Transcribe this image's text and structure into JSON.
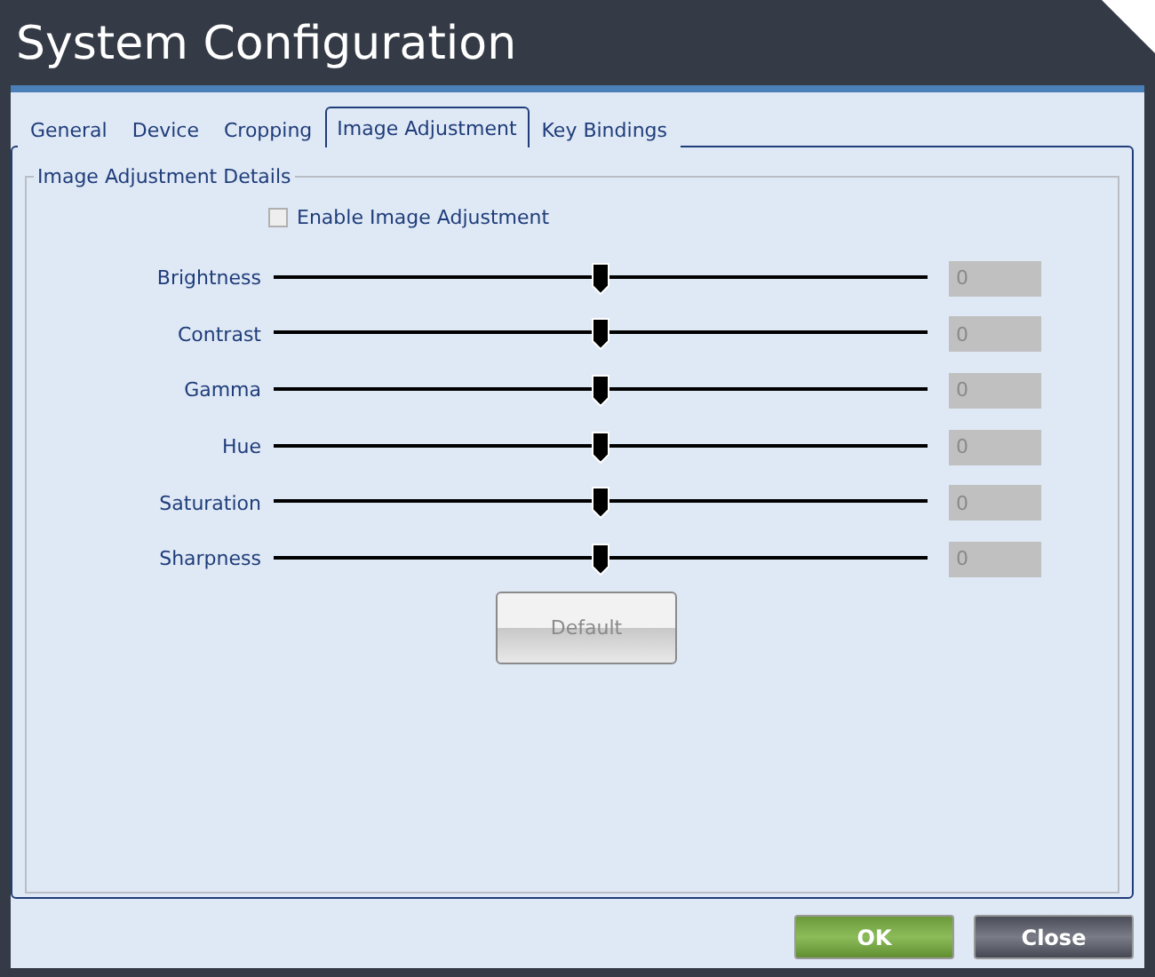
{
  "window": {
    "title": "System Configuration"
  },
  "tabs": [
    {
      "label": "General",
      "selected": false
    },
    {
      "label": "Device",
      "selected": false
    },
    {
      "label": "Cropping",
      "selected": false
    },
    {
      "label": "Image Adjustment",
      "selected": true
    },
    {
      "label": "Key Bindings",
      "selected": false
    }
  ],
  "group": {
    "title": "Image Adjustment Details"
  },
  "enable": {
    "label": "Enable Image Adjustment",
    "checked": false,
    "disabled": true
  },
  "sliders": [
    {
      "label": "Brightness",
      "level": 0.5,
      "value": "0"
    },
    {
      "label": "Contrast",
      "level": 0.5,
      "value": "0"
    },
    {
      "label": "Gamma",
      "level": 0.5,
      "value": "0"
    },
    {
      "label": "Hue",
      "level": 0.5,
      "value": "0"
    },
    {
      "label": "Saturation",
      "level": 0.5,
      "value": "0"
    },
    {
      "label": "Sharpness",
      "level": 0.5,
      "value": "0"
    }
  ],
  "default_button": {
    "label": "Default",
    "disabled": true
  },
  "buttons": [
    {
      "label": "OK",
      "kind": "ok"
    },
    {
      "label": "Close",
      "kind": "close"
    }
  ]
}
